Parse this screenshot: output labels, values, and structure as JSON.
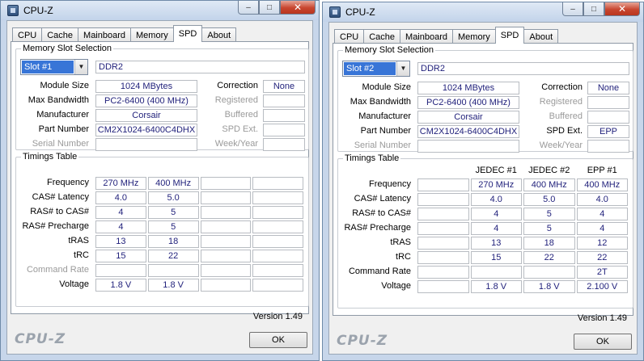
{
  "windows": [
    {
      "title": "CPU-Z",
      "tabs": [
        "CPU",
        "Cache",
        "Mainboard",
        "Memory",
        "SPD",
        "About"
      ],
      "active_tab": "SPD",
      "slot": {
        "group_title": "Memory Slot Selection",
        "selected": "Slot #1",
        "type": "DDR2",
        "labels": {
          "module_size": "Module Size",
          "max_bandwidth": "Max Bandwidth",
          "manufacturer": "Manufacturer",
          "part_number": "Part Number",
          "serial_number": "Serial Number",
          "correction": "Correction",
          "registered": "Registered",
          "buffered": "Buffered",
          "spd_ext": "SPD Ext.",
          "week_year": "Week/Year"
        },
        "values": {
          "module_size": "1024 MBytes",
          "max_bandwidth": "PC2-6400 (400 MHz)",
          "manufacturer": "Corsair",
          "part_number": "CM2X1024-6400C4DHX",
          "serial_number": "",
          "correction": "None",
          "registered": "",
          "buffered": "",
          "spd_ext": "",
          "week_year": ""
        }
      },
      "timings": {
        "group_title": "Timings Table",
        "column_headers": [
          "",
          "",
          "",
          ""
        ],
        "rows": [
          {
            "label": "Frequency",
            "values": [
              "270 MHz",
              "400 MHz",
              "",
              ""
            ]
          },
          {
            "label": "CAS# Latency",
            "values": [
              "4.0",
              "5.0",
              "",
              ""
            ]
          },
          {
            "label": "RAS# to CAS#",
            "values": [
              "4",
              "5",
              "",
              ""
            ]
          },
          {
            "label": "RAS# Precharge",
            "values": [
              "4",
              "5",
              "",
              ""
            ]
          },
          {
            "label": "tRAS",
            "values": [
              "13",
              "18",
              "",
              ""
            ]
          },
          {
            "label": "tRC",
            "values": [
              "15",
              "22",
              "",
              ""
            ]
          },
          {
            "label": "Command Rate",
            "values": [
              "",
              "",
              "",
              ""
            ]
          },
          {
            "label": "Voltage",
            "values": [
              "1.8 V",
              "1.8 V",
              "",
              ""
            ]
          }
        ]
      },
      "version": "Version 1.49",
      "footer_logo": "CPU-Z",
      "ok_label": "OK"
    },
    {
      "title": "CPU-Z",
      "tabs": [
        "CPU",
        "Cache",
        "Mainboard",
        "Memory",
        "SPD",
        "About"
      ],
      "active_tab": "SPD",
      "slot": {
        "group_title": "Memory Slot Selection",
        "selected": "Slot #2",
        "type": "DDR2",
        "labels": {
          "module_size": "Module Size",
          "max_bandwidth": "Max Bandwidth",
          "manufacturer": "Manufacturer",
          "part_number": "Part Number",
          "serial_number": "Serial Number",
          "correction": "Correction",
          "registered": "Registered",
          "buffered": "Buffered",
          "spd_ext": "SPD Ext.",
          "week_year": "Week/Year"
        },
        "values": {
          "module_size": "1024 MBytes",
          "max_bandwidth": "PC2-6400 (400 MHz)",
          "manufacturer": "Corsair",
          "part_number": "CM2X1024-6400C4DHX",
          "serial_number": "",
          "correction": "None",
          "registered": "",
          "buffered": "",
          "spd_ext": "EPP",
          "week_year": ""
        }
      },
      "timings": {
        "group_title": "Timings Table",
        "column_headers": [
          "",
          "JEDEC #1",
          "JEDEC #2",
          "EPP #1"
        ],
        "rows": [
          {
            "label": "Frequency",
            "values": [
              "",
              "270 MHz",
              "400 MHz",
              "400 MHz"
            ]
          },
          {
            "label": "CAS# Latency",
            "values": [
              "",
              "4.0",
              "5.0",
              "4.0"
            ]
          },
          {
            "label": "RAS# to CAS#",
            "values": [
              "",
              "4",
              "5",
              "4"
            ]
          },
          {
            "label": "RAS# Precharge",
            "values": [
              "",
              "4",
              "5",
              "4"
            ]
          },
          {
            "label": "tRAS",
            "values": [
              "",
              "13",
              "18",
              "12"
            ]
          },
          {
            "label": "tRC",
            "values": [
              "",
              "15",
              "22",
              "22"
            ]
          },
          {
            "label": "Command Rate",
            "values": [
              "",
              "",
              "",
              "2T"
            ]
          },
          {
            "label": "Voltage",
            "values": [
              "",
              "1.8 V",
              "1.8 V",
              "2.100 V"
            ]
          }
        ]
      },
      "version": "Version 1.49",
      "footer_logo": "CPU-Z",
      "ok_label": "OK"
    }
  ]
}
